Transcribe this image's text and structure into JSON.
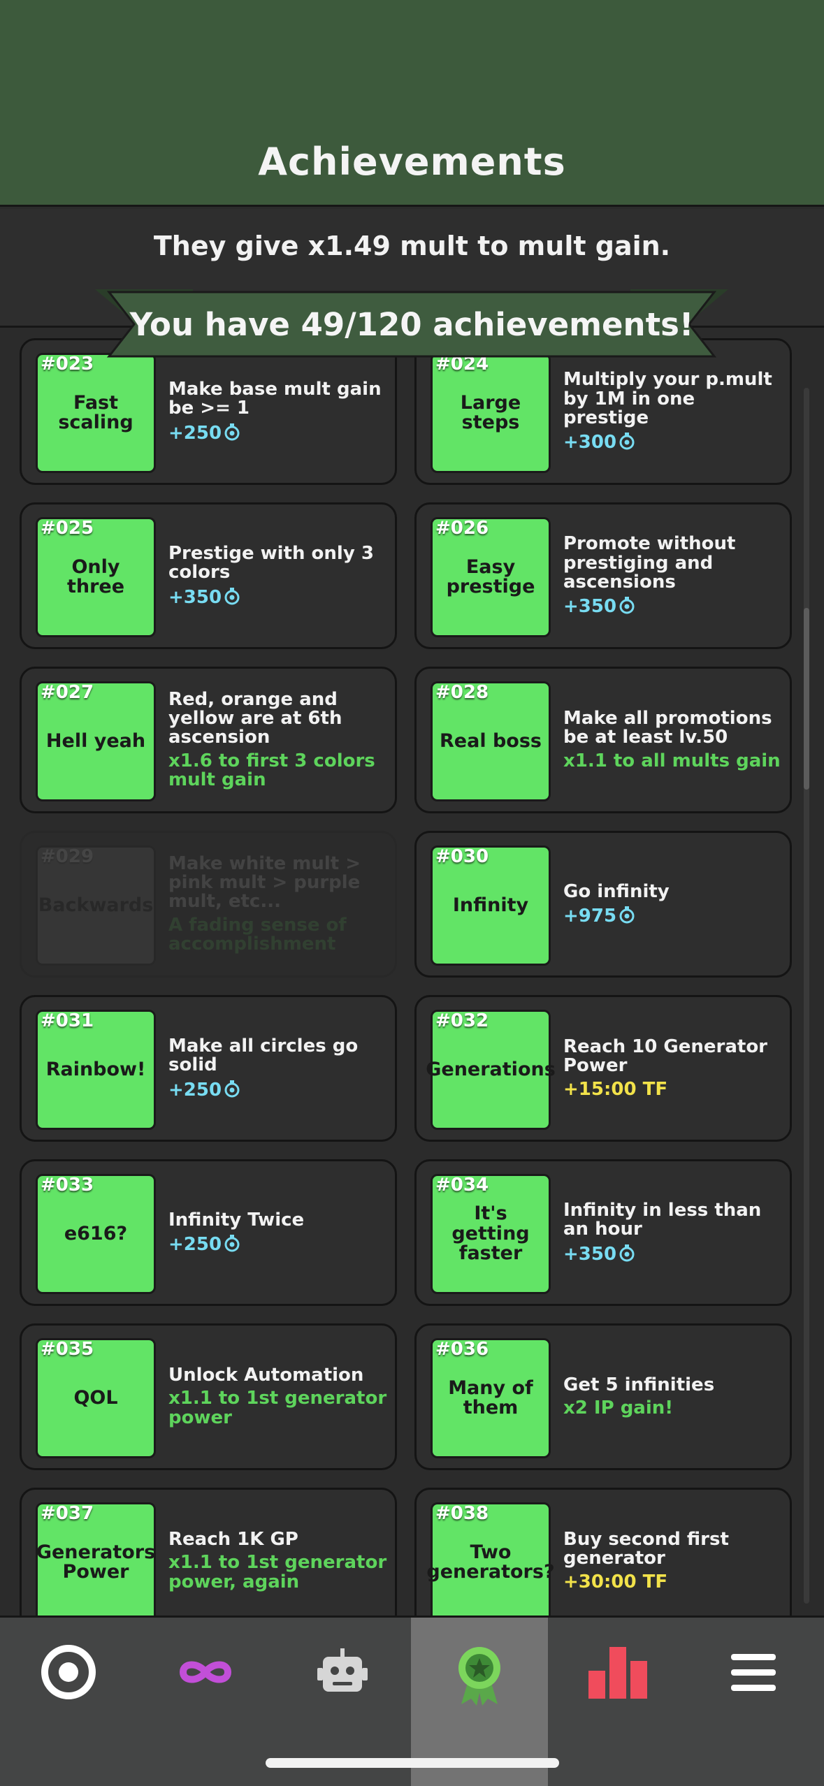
{
  "header": {
    "title": "Achievements"
  },
  "info": {
    "subtitle": "They give x1.49 mult to mult gain.",
    "banner": "You have 49/120 achievements!"
  },
  "achievements": [
    {
      "num": "#023",
      "name": "Fast scaling",
      "desc": "Make base mult gain be >= 1",
      "reward": "+250",
      "reward_type": "currency",
      "locked": false
    },
    {
      "num": "#024",
      "name": "Large steps",
      "desc": "Multiply your p.mult by 1M in one prestige",
      "reward": "+300",
      "reward_type": "currency",
      "locked": false
    },
    {
      "num": "#025",
      "name": "Only three",
      "desc": "Prestige with only 3 colors",
      "reward": "+350",
      "reward_type": "currency",
      "locked": false
    },
    {
      "num": "#026",
      "name": "Easy prestige",
      "desc": "Promote without prestiging and ascensions",
      "reward": "+350",
      "reward_type": "currency",
      "locked": false
    },
    {
      "num": "#027",
      "name": "Hell yeah",
      "desc": "Red, orange and yellow are at 6th ascension",
      "reward": "x1.6 to first 3 colors mult gain",
      "reward_type": "mult",
      "locked": false
    },
    {
      "num": "#028",
      "name": "Real boss",
      "desc": "Make all promotions be at least lv.50",
      "reward": "x1.1 to all mults gain",
      "reward_type": "mult",
      "locked": false
    },
    {
      "num": "#029",
      "name": "Backwards",
      "desc": "Make white mult > pink mult > purple mult, etc...",
      "reward": "A fading sense of accomplishment",
      "reward_type": "mult",
      "locked": true
    },
    {
      "num": "#030",
      "name": "Infinity",
      "desc": "Go infinity",
      "reward": "+975",
      "reward_type": "currency",
      "locked": false
    },
    {
      "num": "#031",
      "name": "Rainbow!",
      "desc": "Make all circles go solid",
      "reward": "+250",
      "reward_type": "currency",
      "locked": false
    },
    {
      "num": "#032",
      "name": "Generations",
      "desc": "Reach 10 Generator Power",
      "reward": "+15:00 TF",
      "reward_type": "time",
      "locked": false
    },
    {
      "num": "#033",
      "name": "e616?",
      "desc": "Infinity Twice",
      "reward": "+250",
      "reward_type": "currency",
      "locked": false
    },
    {
      "num": "#034",
      "name": "It's getting faster",
      "desc": "Infinity in less than an hour",
      "reward": "+350",
      "reward_type": "currency",
      "locked": false
    },
    {
      "num": "#035",
      "name": "QOL",
      "desc": "Unlock Automation",
      "reward": "x1.1 to 1st generator power",
      "reward_type": "mult",
      "locked": false
    },
    {
      "num": "#036",
      "name": "Many of them",
      "desc": "Get 5 infinities",
      "reward": "x2 IP gain!",
      "reward_type": "mult",
      "locked": false
    },
    {
      "num": "#037",
      "name": "Generators Power",
      "desc": "Reach 1K GP",
      "reward": "x1.1 to 1st generator power, again",
      "reward_type": "mult",
      "locked": false
    },
    {
      "num": "#038",
      "name": "Two generators?",
      "desc": "Buy second first generator",
      "reward": "+30:00 TF",
      "reward_type": "time",
      "locked": false
    }
  ],
  "nav": [
    {
      "id": "circle",
      "icon": "target-icon",
      "active": false
    },
    {
      "id": "infinity",
      "icon": "infinity-icon",
      "active": false
    },
    {
      "id": "automation",
      "icon": "robot-icon",
      "active": false
    },
    {
      "id": "achievements",
      "icon": "award-ribbon-icon",
      "active": true
    },
    {
      "id": "stats",
      "icon": "bar-chart-icon",
      "active": false
    },
    {
      "id": "menu",
      "icon": "hamburger-menu-icon",
      "active": false
    }
  ],
  "colors": {
    "header_bg": "#3d5a3c",
    "card_bg": "#2e2e2e",
    "badge_green": "#62e466",
    "reward_blue": "#78dcf2",
    "reward_green": "#5ed45c",
    "reward_yellow": "#f2e24a",
    "infinity_purple": "#c24fd8",
    "stats_red": "#f04c5c"
  }
}
